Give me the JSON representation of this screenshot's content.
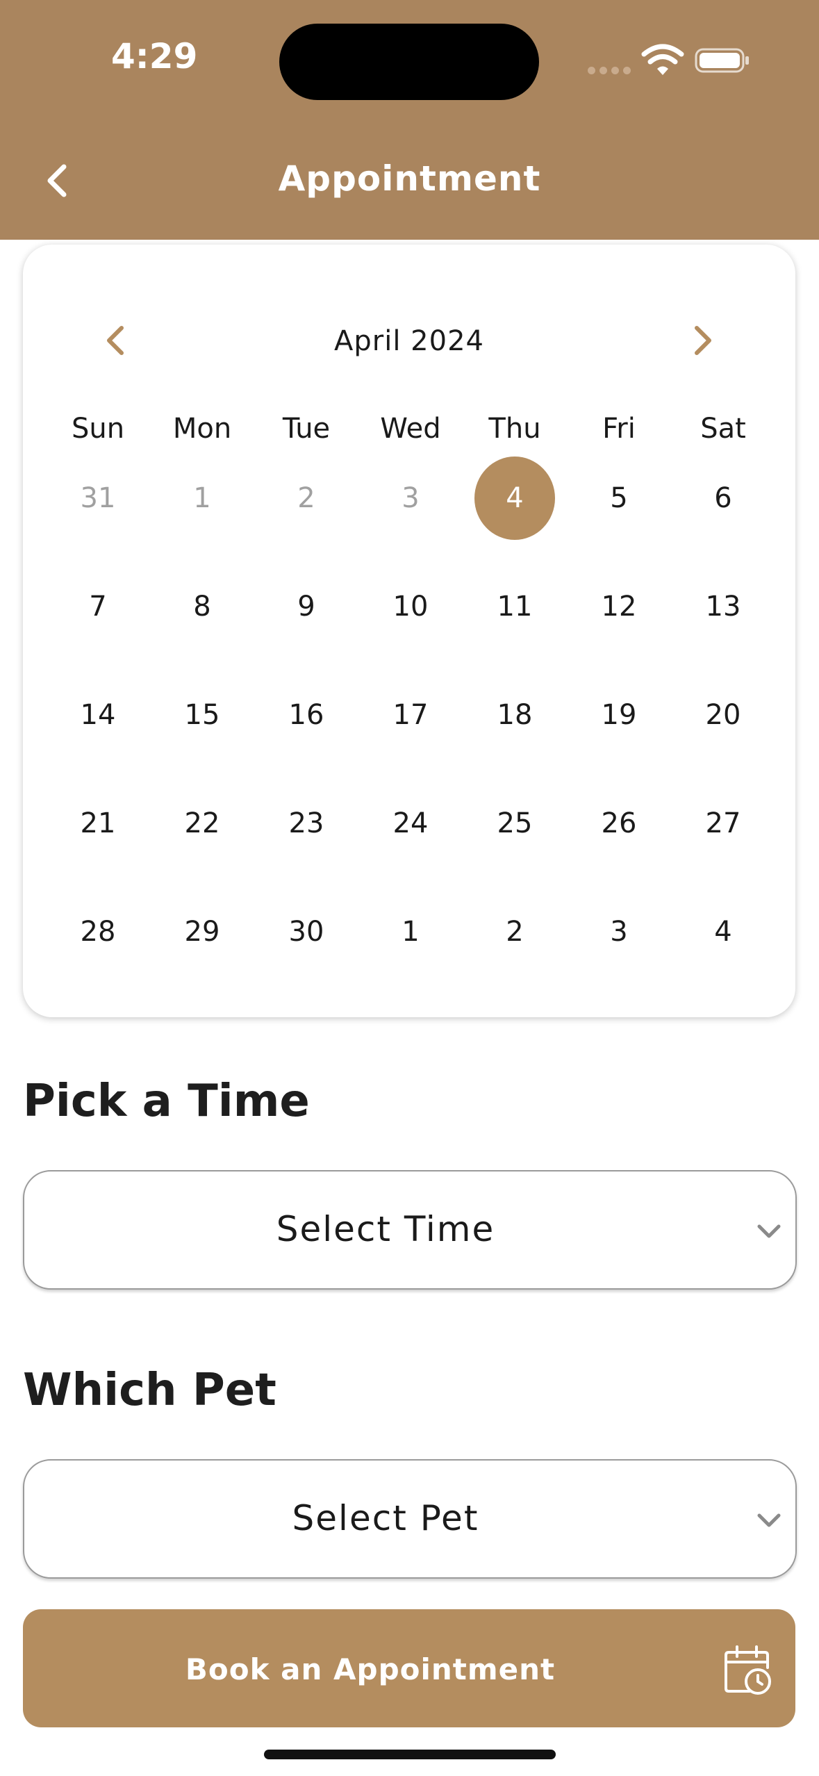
{
  "status_bar": {
    "time": "4:29"
  },
  "header": {
    "title": "Appointment"
  },
  "calendar": {
    "month_label": "April 2024",
    "weekdays": [
      "Sun",
      "Mon",
      "Tue",
      "Wed",
      "Thu",
      "Fri",
      "Sat"
    ],
    "days": [
      {
        "label": "31",
        "muted": true
      },
      {
        "label": "1",
        "muted": true
      },
      {
        "label": "2",
        "muted": true
      },
      {
        "label": "3",
        "muted": true
      },
      {
        "label": "4",
        "selected": true
      },
      {
        "label": "5"
      },
      {
        "label": "6"
      },
      {
        "label": "7"
      },
      {
        "label": "8"
      },
      {
        "label": "9"
      },
      {
        "label": "10"
      },
      {
        "label": "11"
      },
      {
        "label": "12"
      },
      {
        "label": "13"
      },
      {
        "label": "14"
      },
      {
        "label": "15"
      },
      {
        "label": "16"
      },
      {
        "label": "17"
      },
      {
        "label": "18"
      },
      {
        "label": "19"
      },
      {
        "label": "20"
      },
      {
        "label": "21"
      },
      {
        "label": "22"
      },
      {
        "label": "23"
      },
      {
        "label": "24"
      },
      {
        "label": "25"
      },
      {
        "label": "26"
      },
      {
        "label": "27"
      },
      {
        "label": "28"
      },
      {
        "label": "29"
      },
      {
        "label": "30"
      },
      {
        "label": "1"
      },
      {
        "label": "2"
      },
      {
        "label": "3"
      },
      {
        "label": "4"
      }
    ]
  },
  "time_section": {
    "title": "Pick a Time",
    "placeholder": "Select Time"
  },
  "pet_section": {
    "title": "Which Pet",
    "placeholder": "Select Pet"
  },
  "book_button": {
    "label": "Book an Appointment"
  },
  "colors": {
    "brand": "#aa855e",
    "accent": "#b48d5f"
  }
}
